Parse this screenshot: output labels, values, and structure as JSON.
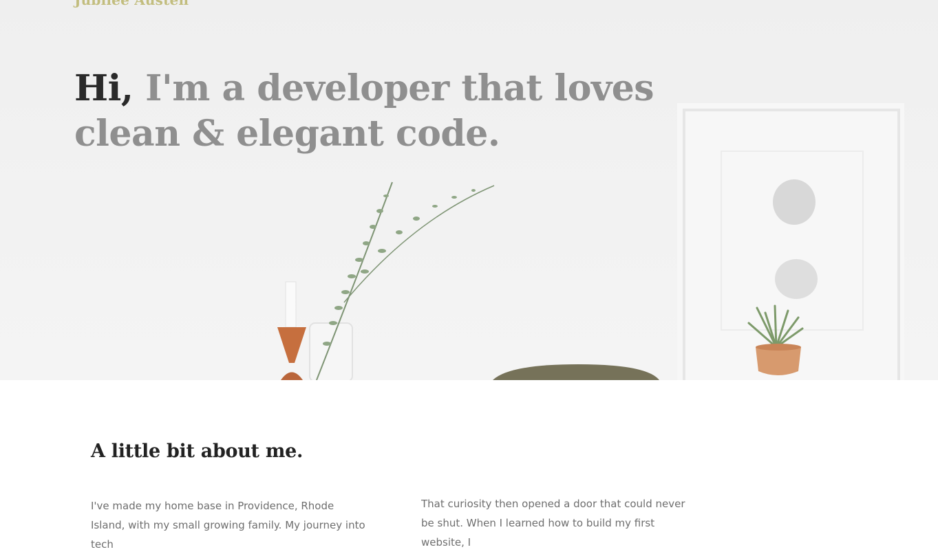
{
  "brand": {
    "name": "Jubilee Austen"
  },
  "hero": {
    "greeting": "Hi,",
    "tagline": " I'm a developer that loves clean & elegant code."
  },
  "about": {
    "title": "A little bit about me.",
    "col_left": "I've made my home base in Providence, Rhode Island, with my small growing family. My journey into tech",
    "col_right": "That curiosity then opened a door that could never be shut. When I learned how to build my first website, I"
  },
  "colors": {
    "brand": "#c2bd7e",
    "greeting": "#2a2a2a",
    "tagline": "#8f8f8f",
    "body_text": "#6e6e6e",
    "hero_bg": "#f1f1f1"
  }
}
